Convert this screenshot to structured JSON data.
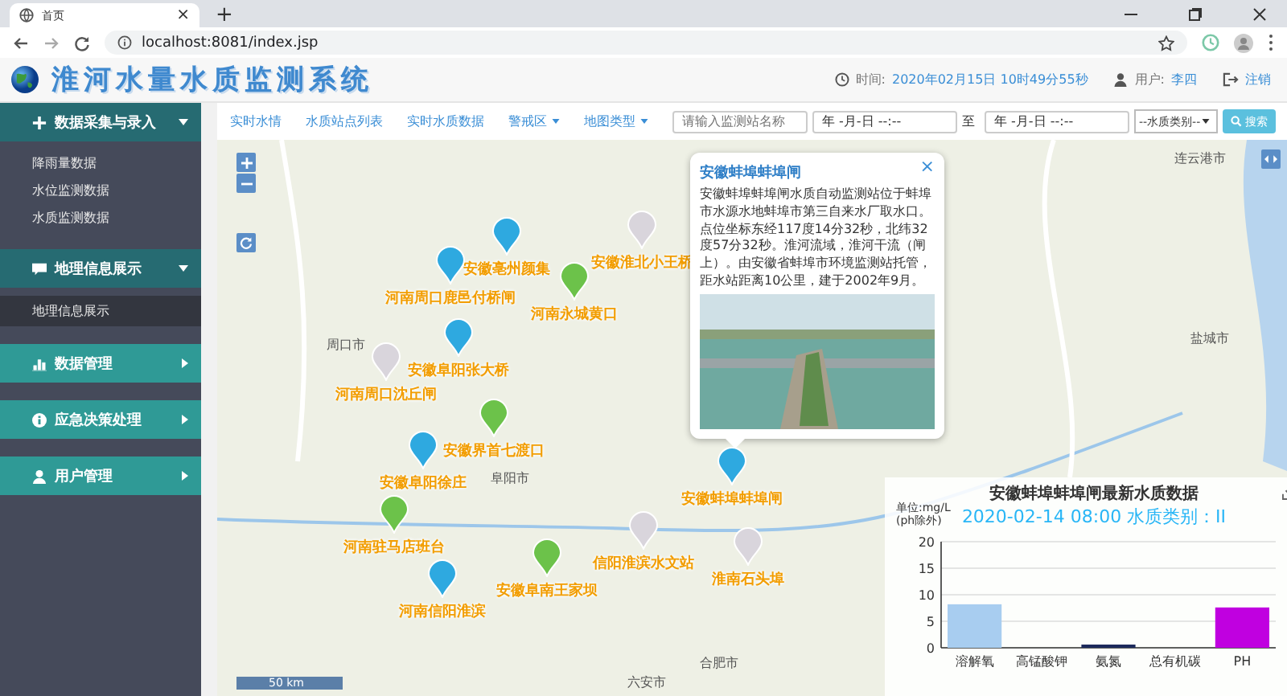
{
  "browser": {
    "tab": {
      "title": "首页",
      "close": "×"
    },
    "new_tab": "+",
    "url": "localhost:8081/index.jsp"
  },
  "header": {
    "title": "淮河水量水质监测系统",
    "time_label": "时间:",
    "time_value": "2020年02月15日 10时49分55秒",
    "user_label": "用户:",
    "user_value": "李四",
    "logout": "注销"
  },
  "nav": {
    "links": [
      {
        "label": "实时水情",
        "dropdown": false
      },
      {
        "label": "水质站点列表",
        "dropdown": false
      },
      {
        "label": "实时水质数据",
        "dropdown": false
      },
      {
        "label": "警戒区",
        "dropdown": true
      },
      {
        "label": "地图类型",
        "dropdown": true
      }
    ],
    "search": {
      "placeholder": "请输入监测站名称"
    },
    "date_from": {
      "value": "年 -月-日 --:--"
    },
    "to_label": "至",
    "date_to": {
      "value": "年 -月-日 --:--"
    },
    "category_select": {
      "value": "--水质类别--"
    },
    "search_button": "搜索"
  },
  "sidebar": {
    "groups": [
      {
        "label": "数据采集与录入",
        "expanded": true,
        "items": [
          {
            "label": "降雨量数据",
            "selected": false
          },
          {
            "label": "水位监测数据",
            "selected": false
          },
          {
            "label": "水质监测数据",
            "selected": false
          }
        ]
      },
      {
        "label": "地理信息展示",
        "expanded": true,
        "items": [
          {
            "label": "地理信息展示",
            "selected": true
          }
        ]
      },
      {
        "label": "数据管理",
        "expanded": false
      },
      {
        "label": "应急决策处理",
        "expanded": false
      },
      {
        "label": "用户管理",
        "expanded": false
      }
    ]
  },
  "map": {
    "cities": [
      "周口市",
      "阜阳市",
      "合肥市",
      "六安市",
      "盐城市",
      "连云港市"
    ],
    "markers": [
      {
        "name": "安徽亳州颜集",
        "color": "#2ea9e0"
      },
      {
        "name": "河南周口鹿邑付桥闸",
        "color": "#2ea9e0"
      },
      {
        "name": "安徽淮北小王桥",
        "color": "#d9d5dc"
      },
      {
        "name": "河南永城黄口",
        "color": "#6cc24a"
      },
      {
        "name": "安徽阜阳张大桥",
        "color": "#2ea9e0"
      },
      {
        "name": "河南周口沈丘闸",
        "color": "#d9d5dc"
      },
      {
        "name": "安徽界首七渡口",
        "color": "#6cc24a"
      },
      {
        "name": "安徽阜阳徐庄",
        "color": "#2ea9e0"
      },
      {
        "name": "河南驻马店班台",
        "color": "#6cc24a"
      },
      {
        "name": "河南信阳淮滨",
        "color": "#2ea9e0"
      },
      {
        "name": "安徽阜南王家坝",
        "color": "#6cc24a"
      },
      {
        "name": "信阳淮滨水文站",
        "color": "#d9d5dc"
      },
      {
        "name": "安徽蚌埠蚌埠闸",
        "color": "#2ea9e0"
      },
      {
        "name": "淮南石头埠",
        "color": "#d9d5dc"
      }
    ],
    "scale": "50 km",
    "popup": {
      "title": "安徽蚌埠蚌埠闸",
      "close": "×",
      "description": "安徽蚌埠蚌埠闸水质自动监测站位于蚌埠市水源水地蚌埠市第三自来水厂取水口。点位坐标东经117度14分32秒，北纬32度57分32秒。淮河流域，淮河干流（闸上）。由安徽省蚌埠市环境监测站托管，距水站距离10公里，建于2002年9月。"
    },
    "chart_panel": {
      "subtitle": "2020-02-14 08:00 水质类别：II",
      "chart_data": {
        "type": "bar",
        "title": "安徽蚌埠蚌埠闸最新水质数据",
        "ylabel": "单位:mg/L (ph除外)",
        "categories": [
          "溶解氧",
          "高锰酸钾",
          "氨氮",
          "总有机碳",
          "PH"
        ],
        "series": [
          {
            "color": "#a8cdf0",
            "values": [
              8.2,
              0,
              null,
              0,
              null
            ]
          },
          {
            "color": "#1c2a5c",
            "values": [
              null,
              null,
              0.5,
              null,
              null
            ]
          },
          {
            "color": "#c000e0",
            "values": [
              null,
              null,
              null,
              null,
              7.6
            ]
          }
        ],
        "ylim": [
          0,
          20
        ],
        "yticks": [
          0,
          5,
          10,
          15,
          20
        ],
        "grid": true
      }
    }
  }
}
